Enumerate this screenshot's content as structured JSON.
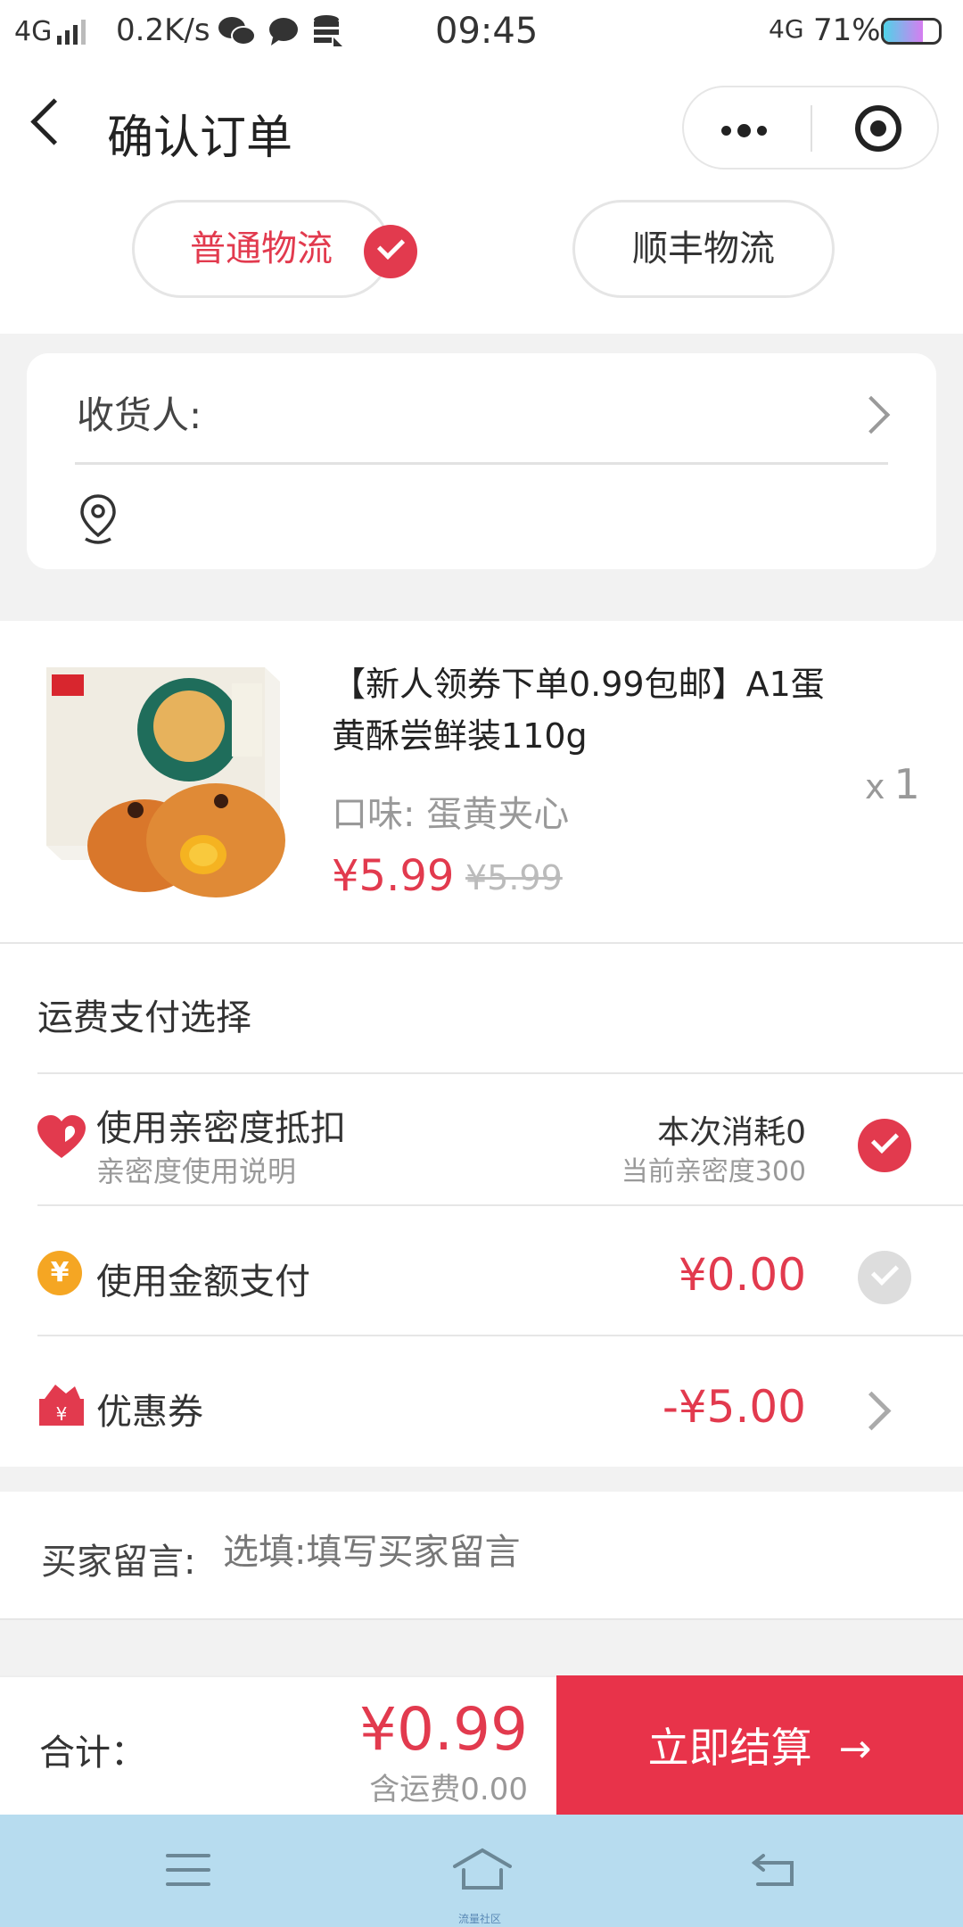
{
  "status_bar": {
    "network": "4G",
    "speed": "0.2K/s",
    "time": "09:45",
    "network_right": "4G",
    "battery": "71%",
    "battery_level": 0.71
  },
  "header": {
    "title": "确认订单"
  },
  "shipping": {
    "options": [
      "普通物流",
      "顺丰物流"
    ],
    "selected": "普通物流"
  },
  "address": {
    "recipient_label": "收货人:"
  },
  "product": {
    "title": "【新人领券下单0.99包邮】A1蛋黄酥尝鲜装110g",
    "flavor": "口味: 蛋黄夹心",
    "price": "¥5.99",
    "original_price": "¥5.99",
    "qty_prefix": "x",
    "qty": "1"
  },
  "payment": {
    "heading": "运费支付选择",
    "intimacy": {
      "label": "使用亲密度抵扣",
      "sub": "亲密度使用说明",
      "consume": "本次消耗0",
      "current": "当前亲密度300",
      "checked": true
    },
    "balance": {
      "label": "使用金额支付",
      "amount": "¥0.00",
      "icon_text": "¥",
      "checked": false
    },
    "coupon": {
      "label": "优惠券",
      "amount": "-¥5.00"
    }
  },
  "message": {
    "label": "买家留言:",
    "placeholder": "选填:填写买家留言"
  },
  "footer": {
    "total_label": "合计：",
    "total_amount": "¥0.99",
    "shipping_note": "含运费0.00",
    "submit_label": "立即结算",
    "submit_arrow": "→"
  },
  "system_nav": {
    "watermark": "流量社区"
  },
  "colors": {
    "accent": "#e23a4e",
    "submit": "#e8334a",
    "nav_bg": "#b7dcef"
  }
}
